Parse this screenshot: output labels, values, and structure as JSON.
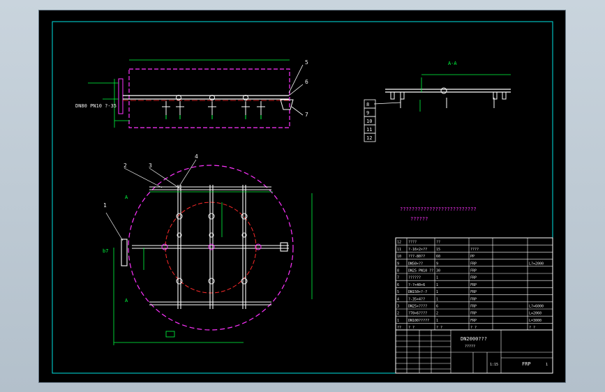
{
  "colors": {
    "background": "#000000",
    "frame": "#00e5e5",
    "pipe": "#ffffff",
    "hidden": "#ff33ff",
    "circle": "#ff2a2a",
    "dim": "#00ff40",
    "text": "#f2f2f2"
  },
  "callouts": {
    "c1": "1",
    "c2": "2",
    "c3": "3",
    "c4": "4",
    "c5": "5",
    "c6": "6",
    "c7": "7",
    "c8": "8",
    "c9": "9",
    "c10": "10",
    "c11": "11",
    "c12": "12"
  },
  "section_label": "A-A",
  "elevation_note": "DN80 PN10 ?-35",
  "plan_note_b": "b7",
  "plan_note_a1": "A",
  "plan_note_a2": "A",
  "tech_note_1": "??????????????????????????",
  "tech_note_2": "??????",
  "bom_rows": [
    {
      "no": "12",
      "name": "????",
      "qty": "??",
      "unit": "",
      "note": ""
    },
    {
      "no": "11",
      "name": "?-16×2×??",
      "qty": "15",
      "unit": "????",
      "note": ""
    },
    {
      "no": "10",
      "name": "???-80??",
      "qty": "60",
      "unit": "PP",
      "note": ""
    },
    {
      "no": "9",
      "name": "DN50×??",
      "qty": "9",
      "unit": "FRP",
      "note": "L?=2000"
    },
    {
      "no": "8",
      "name": "DN25 PN10 ??",
      "qty": "30",
      "unit": "FRP",
      "note": ""
    },
    {
      "no": "7",
      "name": "??????",
      "qty": "1",
      "unit": "FRP",
      "note": ""
    },
    {
      "no": "6",
      "name": "?-?×40×6",
      "qty": "1",
      "unit": "FRP",
      "note": ""
    },
    {
      "no": "5",
      "name": "DN150×?-?",
      "qty": "1",
      "unit": "FRP",
      "note": ""
    },
    {
      "no": "4",
      "name": "?-35×4??",
      "qty": "1",
      "unit": "FRP",
      "note": ""
    },
    {
      "no": "3",
      "name": "DN25×????",
      "qty": "6",
      "unit": "FRP",
      "note": "L?=6000"
    },
    {
      "no": "2",
      "name": "?70×6????",
      "qty": "2",
      "unit": "FRP",
      "note": "L=2060"
    },
    {
      "no": "1",
      "name": "DN100?????",
      "qty": "1",
      "unit": "FRP",
      "note": "L=3000"
    }
  ],
  "bom_header": {
    "no": "??",
    "name": "? ?",
    "qty": "? ?",
    "unit": "? ?",
    "note": "? ?"
  },
  "title_block": {
    "title": "DN2000???",
    "subtitle": "?????",
    "scale": "1:15",
    "material": "FRP",
    "sheet": "1"
  }
}
